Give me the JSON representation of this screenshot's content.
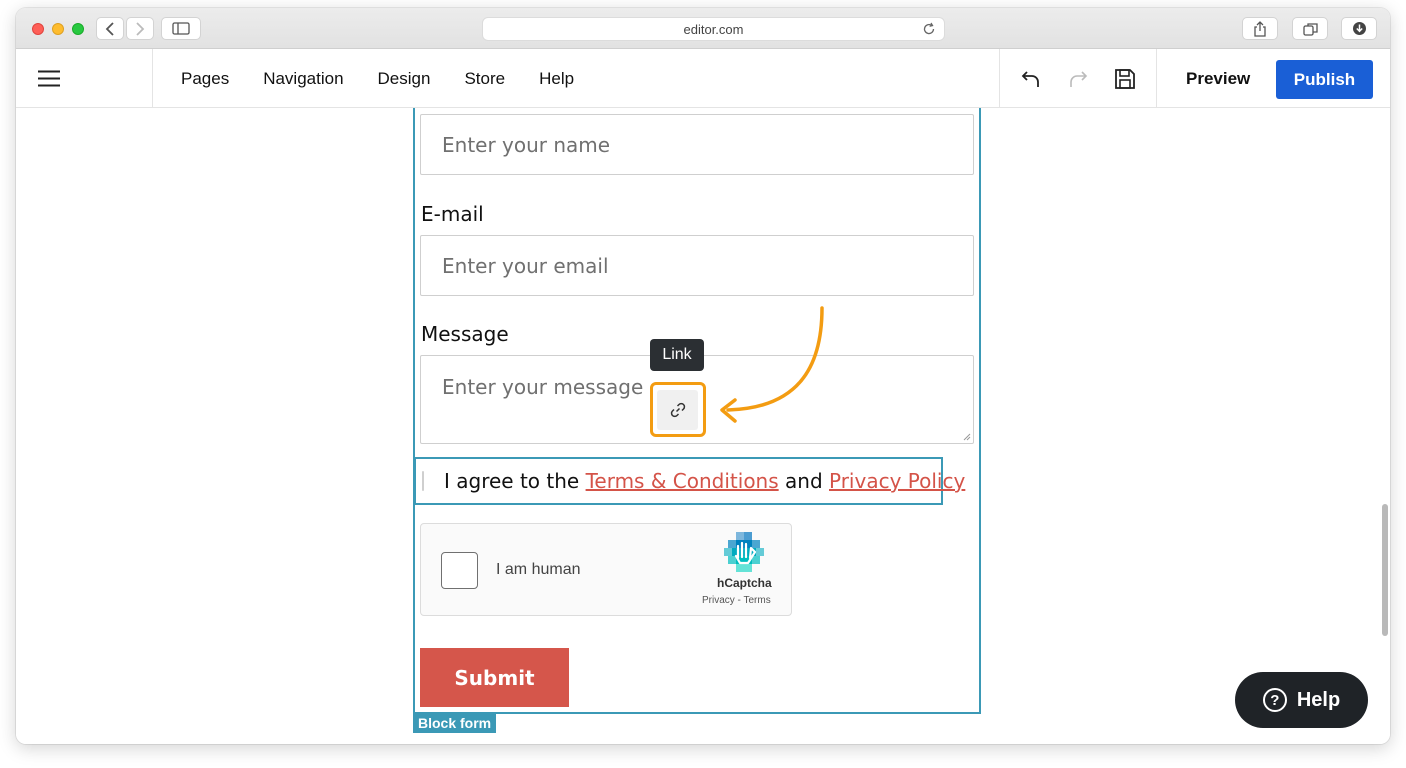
{
  "browser": {
    "url": "editor.com"
  },
  "toolbar": {
    "nav": [
      "Pages",
      "Navigation",
      "Design",
      "Store",
      "Help"
    ],
    "preview_label": "Preview",
    "publish_label": "Publish"
  },
  "form": {
    "name_placeholder": "Enter your name",
    "email_label": "E-mail",
    "email_placeholder": "Enter your email",
    "message_label": "Message",
    "message_placeholder": "Enter your message",
    "agree_prefix": "I agree to the ",
    "terms_link": "Terms & Conditions",
    "agree_and": " and ",
    "privacy_link": "Privacy Policy",
    "submit_label": "Submit",
    "block_label": "Block form"
  },
  "tooltip": {
    "text": "Link"
  },
  "captcha": {
    "label": "I am human",
    "brand": "hCaptcha",
    "links": "Privacy - Terms"
  },
  "help_button": {
    "label": "Help"
  },
  "colors": {
    "accent": "#1a5fd6",
    "block_outline": "#3b99b6",
    "highlight": "#f39c12",
    "submit": "#d5564b",
    "link": "#d45348"
  }
}
